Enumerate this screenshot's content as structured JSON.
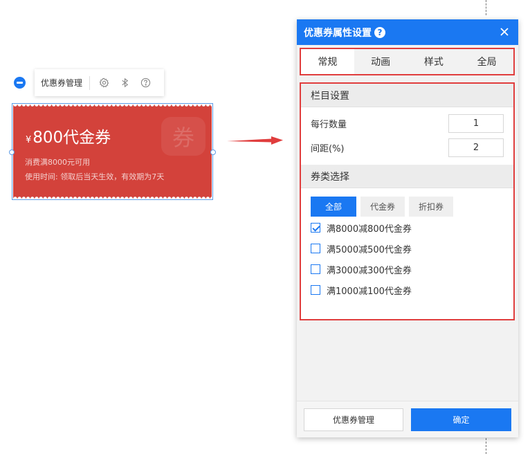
{
  "toolbar": {
    "label": "优惠券管理",
    "icons": [
      "gear-icon",
      "bluetooth-icon",
      "help-circle-icon"
    ]
  },
  "coupon": {
    "currency": "¥",
    "title": "800代金券",
    "condition": "消费满8000元可用",
    "validity": "使用时间: 领取后当天生效，有效期为7天",
    "stamp": "券",
    "color": "#d3423b"
  },
  "dialog": {
    "title": "优惠券属性设置",
    "help": "?",
    "tabs": [
      {
        "label": "常规",
        "active": true
      },
      {
        "label": "动画",
        "active": false
      },
      {
        "label": "样式",
        "active": false
      },
      {
        "label": "全局",
        "active": false
      }
    ],
    "column_section": {
      "title": "栏目设置",
      "per_row_label": "每行数量",
      "per_row_value": "1",
      "spacing_label": "间距(%)",
      "spacing_value": "2"
    },
    "type_section": {
      "title": "券类选择",
      "filters": [
        {
          "label": "全部",
          "active": true
        },
        {
          "label": "代金券",
          "active": false
        },
        {
          "label": "折扣券",
          "active": false
        }
      ],
      "coupons": [
        {
          "label": "满8000减800代金券",
          "checked": true
        },
        {
          "label": "满5000减500代金券",
          "checked": false
        },
        {
          "label": "满3000减300代金券",
          "checked": false
        },
        {
          "label": "满1000减100代金券",
          "checked": false
        }
      ]
    },
    "footer": {
      "manage_label": "优惠券管理",
      "ok_label": "确定"
    }
  },
  "colors": {
    "accent": "#1a78f2",
    "highlight": "#e03d3d"
  }
}
